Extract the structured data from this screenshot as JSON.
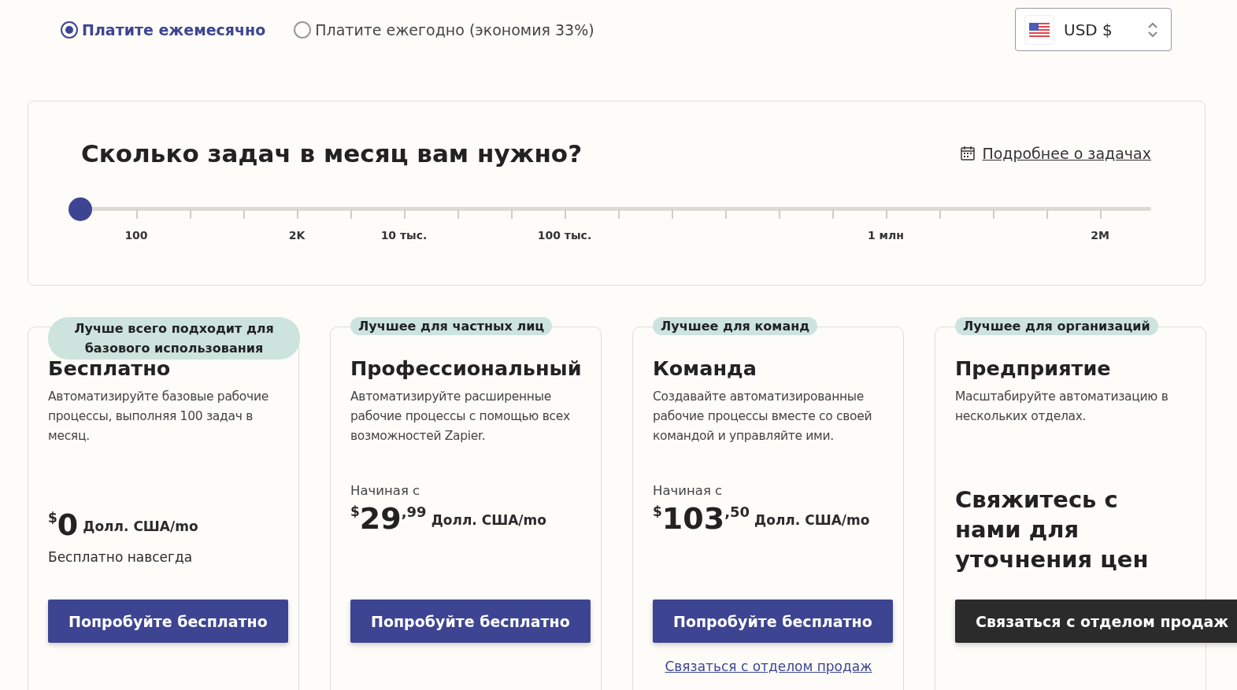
{
  "billing": [
    {
      "label": "Платите ежемесячно",
      "selected": true
    },
    {
      "label": "Платите ежегодно (экономия 33%)",
      "selected": false
    }
  ],
  "currency": {
    "value": "USD $"
  },
  "tasks": {
    "title": "Сколько задач в месяц вам нужно?",
    "link": "Подробнее о задачах",
    "level": 0,
    "tick_labels": [
      "100",
      "2K",
      "10 тыс.",
      "100 тыс.",
      "1 млн",
      "2M"
    ]
  },
  "plans": [
    {
      "badge": "Лучше всего подходит для базового использования",
      "title": "Бесплатно",
      "description": "Автоматизируйте базовые рабочие процессы, выполняя 100 задач в месяц.",
      "price": {
        "currency": "$",
        "amount": "0",
        "unit": "Долл. США/mo"
      },
      "note": "Бесплатно навсегда",
      "button": {
        "label": "Попробуйте бесплатно",
        "kind": "primary"
      }
    },
    {
      "badge": "Лучшее для частных лиц",
      "title": "Профессиональный",
      "description": "Автоматизируйте расширенные рабочие процессы с помощью всех возможностей Zapier.",
      "starting": "Начиная с",
      "price": {
        "currency": "$",
        "amount": "29",
        "cents": ",99",
        "unit": "Долл. США/mo"
      },
      "button": {
        "label": "Попробуйте бесплатно",
        "kind": "primary"
      }
    },
    {
      "badge": "Лучшее для команд",
      "title": "Команда",
      "description": "Создавайте автоматизированные рабочие процессы вместе со своей командой и управляйте ими.",
      "starting": "Начиная с",
      "price": {
        "currency": "$",
        "amount": "103",
        "cents": ",50",
        "unit": "Долл. США/mo"
      },
      "button": {
        "label": "Попробуйте бесплатно",
        "kind": "primary"
      },
      "link": "Связаться с отделом продаж"
    },
    {
      "badge": "Лучшее для организаций",
      "title": "Предприятие",
      "description": "Масштабируйте автоматизацию в нескольких отделах.",
      "contact": "Свяжитесь с нами для уточнения цен",
      "button": {
        "label": "Связаться с отделом продаж",
        "kind": "dark"
      }
    }
  ]
}
